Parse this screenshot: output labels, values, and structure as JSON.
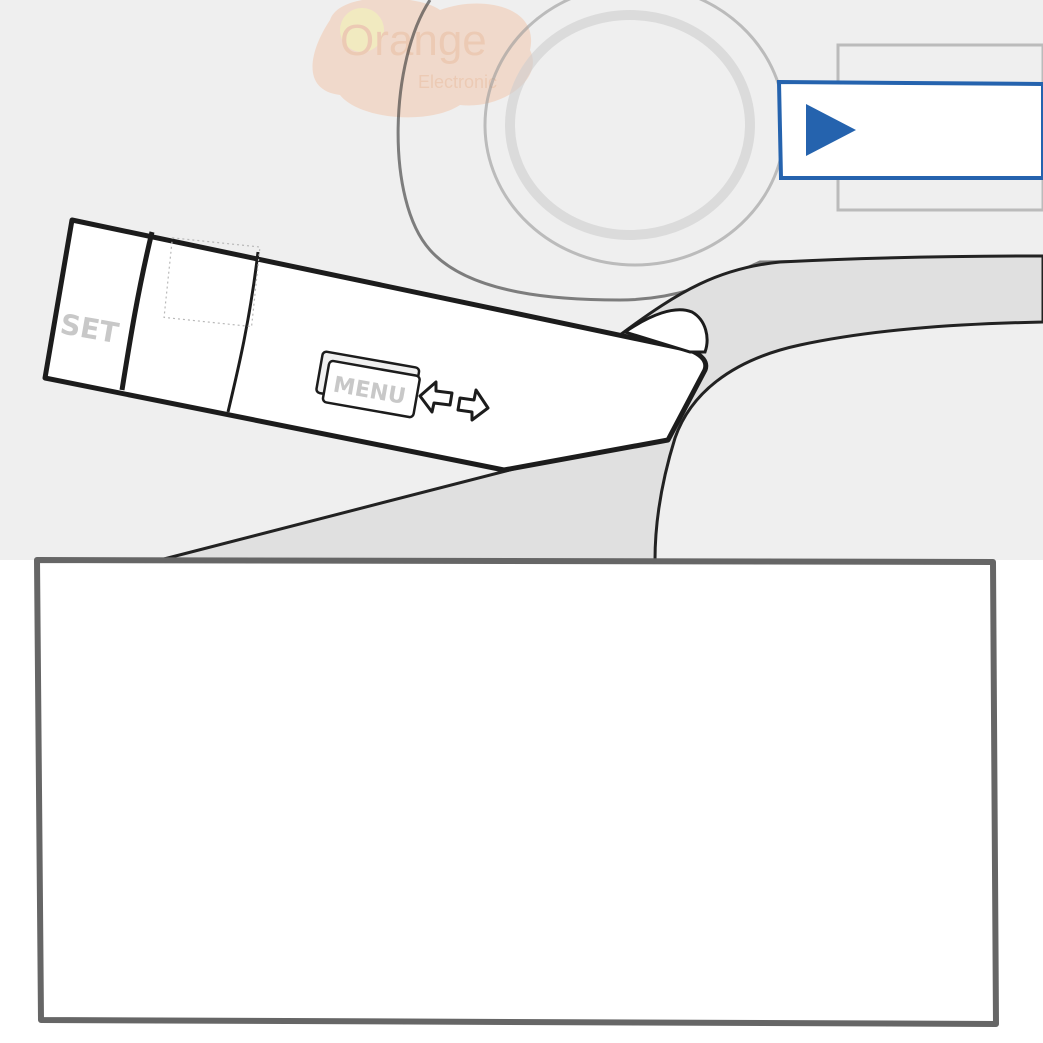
{
  "watermark": {
    "brand_line1": "Orange",
    "brand_line2": "Electronic"
  },
  "stalk": {
    "set_label": "SET",
    "menu_label": "MENU",
    "arrows_icon": "left-right-arrows-icon"
  },
  "play_panel": {
    "icon": "play-triangle-icon",
    "accent_color": "#2563ae"
  },
  "instruction_box": {
    "text": ""
  },
  "colors": {
    "background": "#efefef",
    "stroke": "#222222",
    "box_border": "#666666"
  }
}
